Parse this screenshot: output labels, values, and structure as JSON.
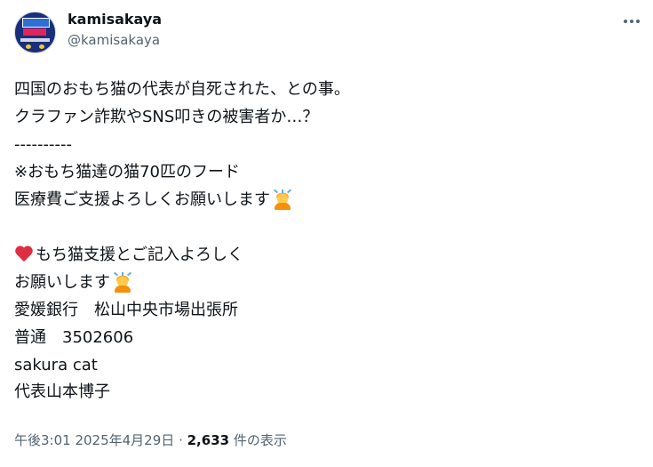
{
  "author": {
    "display_name": "kamisakaya",
    "handle": "@kamisakaya"
  },
  "tweet": {
    "lines": [
      "四国のおもち猫の代表が自死された、との事。",
      "クラファン詐欺やSNS叩きの被害者か…？",
      "----------",
      "※おもち猫達の猫70匹のフード",
      "医療費ご支援よろしくお願いします",
      "もち猫支援とご記入よろしく",
      "お願いします",
      "愛媛銀行　松山中央市場出張所",
      "普通　3502606",
      "sakura cat",
      "代表山本博子"
    ]
  },
  "meta": {
    "time": "午後3:01",
    "separator": "·",
    "date": "2025年4月29日",
    "views_count": "2,633",
    "views_label": "件の表示"
  },
  "icons": [
    "avatar",
    "more-icon",
    "person-bowing-icon",
    "red-heart-icon"
  ]
}
